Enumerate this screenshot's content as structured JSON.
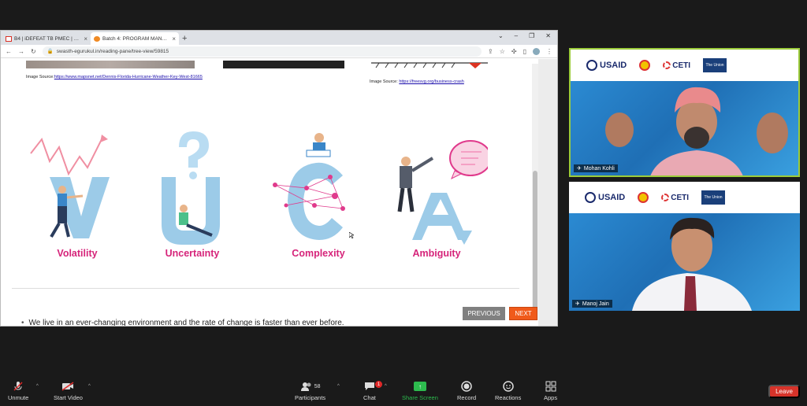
{
  "browser": {
    "tabs": [
      {
        "title": "B4 | iDEFEAT TB PMEC | Leaders",
        "icon": "gmail-icon",
        "active": false
      },
      {
        "title": "Batch 4: PROGRAM MANAGEM",
        "icon": "site-icon",
        "active": true
      }
    ],
    "url": "swasth-egurukul.in/reading-pane/tree-view/59815"
  },
  "page": {
    "image_source_label": "Image Source:",
    "image_source_1_url": "https://www.mapsnet.net/Dennis-Florida-Hurricane-Weather-Key-West-81665",
    "image_source_2_url": "https://freesvg.org/business-crash",
    "vuca": [
      {
        "label": "Volatility",
        "letter": "V"
      },
      {
        "label": "Uncertainty",
        "letter": "U"
      },
      {
        "label": "Complexity",
        "letter": "C"
      },
      {
        "label": "Ambiguity",
        "letter": "A"
      }
    ],
    "bullet": "We live in an ever-changing environment and the rate of change is faster than ever before.",
    "previous_label": "PREVIOUS",
    "next_label": "NEXT"
  },
  "participants": [
    {
      "name": "Mohan Kohli"
    },
    {
      "name": "Manoj Jain"
    }
  ],
  "logos": {
    "usaid": "USAID",
    "ceti": "CETI",
    "union": "The Union"
  },
  "toolbar": {
    "unmute": "Unmute",
    "start_video": "Start Video",
    "participants": "Participants",
    "participants_count": "58",
    "chat": "Chat",
    "chat_badge": "1",
    "share_screen": "Share Screen",
    "record": "Record",
    "reactions": "Reactions",
    "apps": "Apps",
    "leave": "Leave"
  },
  "colors": {
    "accent_pink": "#d6247a",
    "next_orange": "#f05a1a",
    "share_green": "#2dbb4e",
    "leave_red": "#d7332a",
    "speaker_border": "#9ccc3b"
  }
}
